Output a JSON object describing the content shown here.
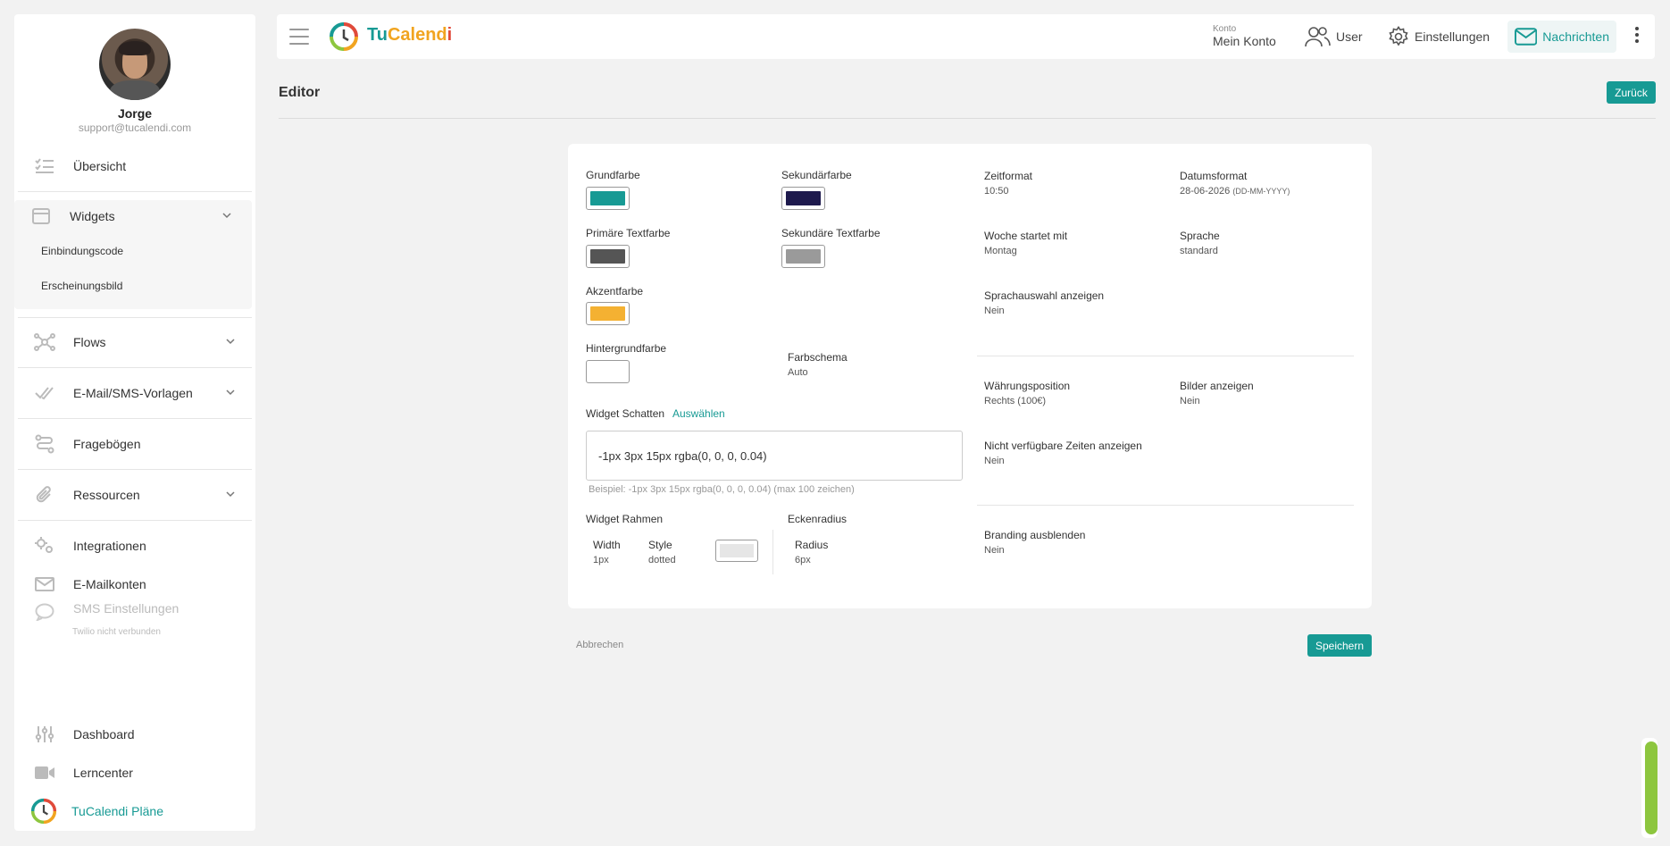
{
  "user": {
    "name": "Jorge",
    "email": "support@tucalendi.com"
  },
  "sidebar": {
    "items": [
      {
        "label": "Übersicht"
      },
      {
        "label": "Widgets"
      },
      {
        "label": "Flows"
      },
      {
        "label": "E-Mail/SMS-Vorlagen"
      },
      {
        "label": "Fragebögen"
      },
      {
        "label": "Ressourcen"
      },
      {
        "label": "Integrationen"
      },
      {
        "label": "E-Mailkonten"
      },
      {
        "label": "SMS Einstellungen",
        "sub": "Twilio nicht verbunden"
      }
    ],
    "widget_subitems": [
      {
        "label": "Einbindungscode"
      },
      {
        "label": "Erscheinungsbild"
      }
    ],
    "bottom": [
      {
        "label": "Dashboard"
      },
      {
        "label": "Lerncenter"
      },
      {
        "label": "TuCalendi Pläne"
      }
    ]
  },
  "topbar": {
    "logo_tu": "Tu",
    "logo_cal": "Calend",
    "logo_i": "i",
    "konto_small": "Konto",
    "konto_big": "Mein Konto",
    "user_label": "User",
    "settings_label": "Einstellungen",
    "messages_label": "Nachrichten"
  },
  "page": {
    "title": "Editor",
    "back_label": "Zurück"
  },
  "editor": {
    "colors": {
      "grundfarbe": {
        "label": "Grundfarbe",
        "value": "#179a94"
      },
      "sekundaerfarbe": {
        "label": "Sekundärfarbe",
        "value": "#1e1a4d"
      },
      "primaere_textfarbe": {
        "label": "Primäre Textfarbe",
        "value": "#555555"
      },
      "sekundaere_textfarbe": {
        "label": "Sekundäre Textfarbe",
        "value": "#9a9a9a"
      },
      "akzentfarbe": {
        "label": "Akzentfarbe",
        "value": "#f4b132"
      },
      "hintergrundfarbe": {
        "label": "Hintergrundfarbe",
        "value": "#ffffff"
      }
    },
    "farbschema": {
      "label": "Farbschema",
      "value": "Auto"
    },
    "widget_schatten": {
      "label": "Widget Schatten",
      "select_label": "Auswählen",
      "value": "-1px 3px 15px rgba(0, 0, 0, 0.04)",
      "hint": "Beispiel: -1px 3px 15px rgba(0, 0, 0, 0.04) (max 100 zeichen)"
    },
    "widget_rahmen": {
      "label": "Widget Rahmen",
      "width_label": "Width",
      "width_value": "1px",
      "style_label": "Style",
      "style_value": "dotted",
      "color": "#e6e6e6"
    },
    "eckenradius": {
      "label": "Eckenradius",
      "radius_label": "Radius",
      "radius_value": "6px"
    },
    "zeitformat": {
      "label": "Zeitformat",
      "value": "10:50"
    },
    "datumsformat": {
      "label": "Datumsformat",
      "value": "28-06-2026",
      "format": "(DD-MM-YYYY)"
    },
    "woche_startet": {
      "label": "Woche startet mit",
      "value": "Montag"
    },
    "sprache": {
      "label": "Sprache",
      "value": "standard"
    },
    "sprachauswahl": {
      "label": "Sprachauswahl anzeigen",
      "value": "Nein"
    },
    "waehrungsposition": {
      "label": "Währungsposition",
      "value": "Rechts (100€)"
    },
    "bilder_anzeigen": {
      "label": "Bilder anzeigen",
      "value": "Nein"
    },
    "nicht_verfuegbare": {
      "label": "Nicht verfügbare Zeiten anzeigen",
      "value": "Nein"
    },
    "branding": {
      "label": "Branding ausblenden",
      "value": "Nein"
    }
  },
  "actions": {
    "cancel_label": "Abbrechen",
    "save_label": "Speichern"
  },
  "theme": {
    "accent": "#179a94",
    "scroll": "#8dc63f"
  }
}
